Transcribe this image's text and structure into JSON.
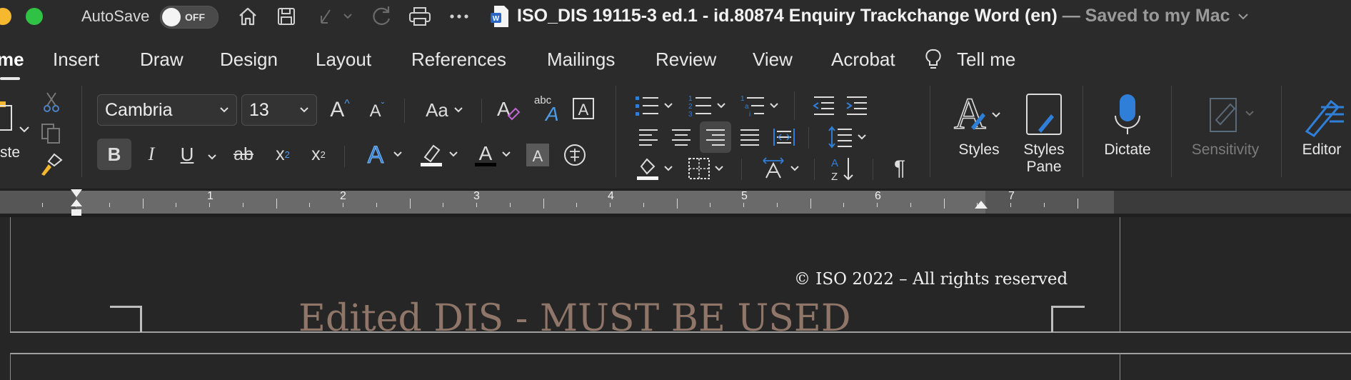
{
  "window": {
    "autosave_label": "AutoSave",
    "autosave_state": "OFF",
    "doc_title": "ISO_DIS 19115-3 ed.1 - id.80874 Enquiry Trackchange Word (en)",
    "saved_status": "— Saved to my Mac"
  },
  "quick_access": {
    "icons": [
      "home-icon",
      "save-icon",
      "undo-icon",
      "redo-icon",
      "print-icon",
      "more-icon"
    ]
  },
  "tabs": [
    {
      "label": "me",
      "active": true
    },
    {
      "label": "Insert"
    },
    {
      "label": "Draw"
    },
    {
      "label": "Design"
    },
    {
      "label": "Layout"
    },
    {
      "label": "References"
    },
    {
      "label": "Mailings"
    },
    {
      "label": "Review"
    },
    {
      "label": "View"
    },
    {
      "label": "Acrobat"
    },
    {
      "label": "Tell me"
    }
  ],
  "ribbon": {
    "paste_label": "ste",
    "font_name": "Cambria",
    "font_size": "13",
    "change_case": "Aa",
    "abc_label": "abc",
    "styles_label": "Styles",
    "styles_pane_line1": "Styles",
    "styles_pane_line2": "Pane",
    "dictate_label": "Dictate",
    "sensitivity_label": "Sensitivity",
    "editor_label": "Editor",
    "bold": "B",
    "italic": "I",
    "underline": "U",
    "strikethrough": "ab",
    "subscript": "x",
    "superscript": "x",
    "accent_color": "#2f7ed8"
  },
  "ruler": {
    "numbers": [
      "1",
      "2",
      "3",
      "4",
      "5",
      "6",
      "7"
    ]
  },
  "document": {
    "copyright": "© ISO 2022 – All rights reserved",
    "watermark": "Edited DIS - MUST BE USED"
  }
}
